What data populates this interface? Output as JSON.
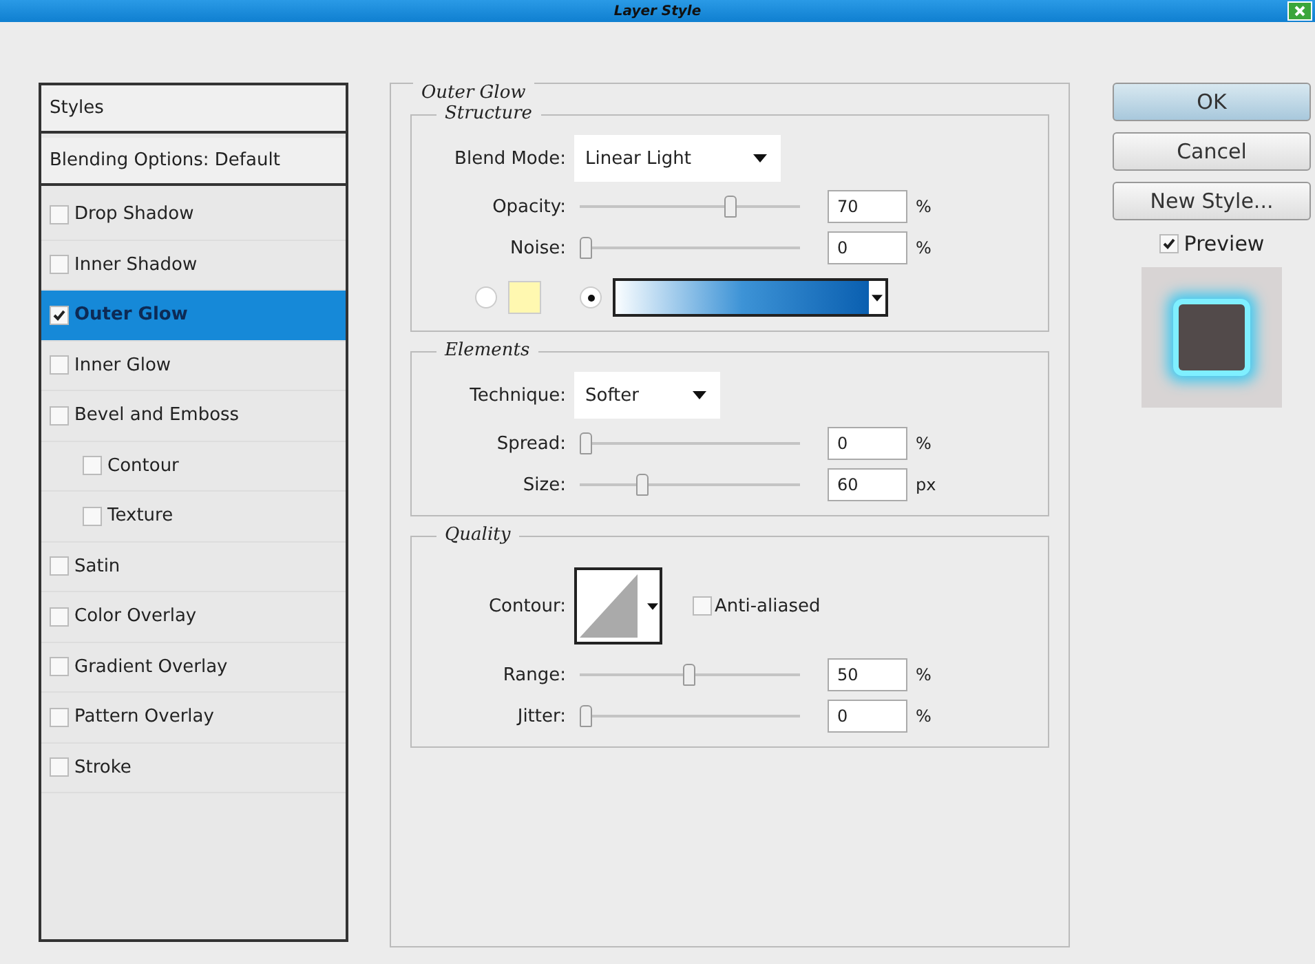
{
  "window": {
    "title": "Layer Style"
  },
  "styles_list": {
    "header": "Styles",
    "blending": "Blending Options: Default",
    "items": [
      {
        "label": "Drop Shadow",
        "checked": false,
        "selected": false
      },
      {
        "label": "Inner Shadow",
        "checked": false,
        "selected": false
      },
      {
        "label": "Outer Glow",
        "checked": true,
        "selected": true
      },
      {
        "label": "Inner Glow",
        "checked": false,
        "selected": false
      },
      {
        "label": "Bevel and Emboss",
        "checked": false,
        "selected": false,
        "children": [
          {
            "label": "Contour",
            "checked": false,
            "selected": false
          },
          {
            "label": "Texture",
            "checked": false,
            "selected": false
          }
        ]
      },
      {
        "label": "Satin",
        "checked": false,
        "selected": false
      },
      {
        "label": "Color Overlay",
        "checked": false,
        "selected": false
      },
      {
        "label": "Gradient Overlay",
        "checked": false,
        "selected": false
      },
      {
        "label": "Pattern Overlay",
        "checked": false,
        "selected": false
      },
      {
        "label": "Stroke",
        "checked": false,
        "selected": false
      }
    ]
  },
  "panel": {
    "title": "Outer Glow",
    "structure": {
      "title": "Structure",
      "blend_mode": {
        "label": "Blend Mode:",
        "value": "Linear Light"
      },
      "sliders": [
        {
          "label": "Opacity:",
          "value": "70",
          "unit": "%",
          "level": 0.7
        },
        {
          "label": "Noise:",
          "value": "0",
          "unit": "%",
          "level": 0
        }
      ],
      "fill": [
        {
          "kind": "color",
          "selected": false
        },
        {
          "kind": "gradient",
          "selected": true
        }
      ]
    },
    "elements": {
      "title": "Elements",
      "technique": {
        "label": "Technique:",
        "value": "Softer"
      },
      "sliders": [
        {
          "label": "Spread:",
          "value": "0",
          "unit": "%",
          "level": 0
        },
        {
          "label": "Size:",
          "value": "60",
          "unit": "px",
          "level": 0.27
        }
      ]
    },
    "quality": {
      "title": "Quality",
      "contour_label": "Contour:",
      "anti_aliased": {
        "label": "Anti-aliased",
        "checked": false
      },
      "sliders": [
        {
          "label": "Range:",
          "value": "50",
          "unit": "%",
          "level": 0.5
        },
        {
          "label": "Jitter:",
          "value": "0",
          "unit": "%",
          "level": 0
        }
      ]
    }
  },
  "buttons": [
    {
      "label": "OK",
      "selected": true
    },
    {
      "label": "Cancel",
      "selected": false
    },
    {
      "label": "New Style...",
      "selected": false
    }
  ],
  "preview": {
    "label": "Preview",
    "checked": true
  }
}
